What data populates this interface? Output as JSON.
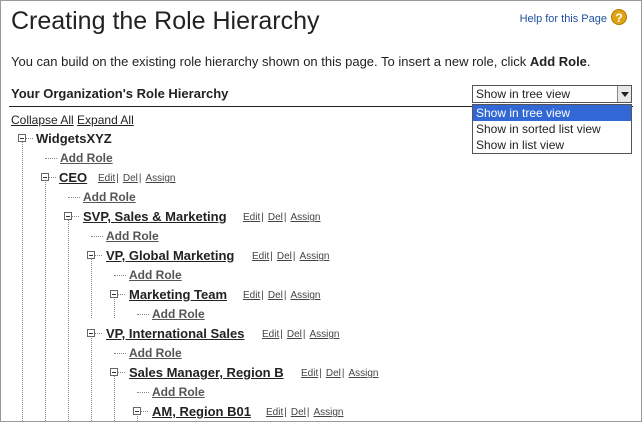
{
  "header": {
    "title": "Creating the Role Hierarchy",
    "help_link": "Help for this Page",
    "help_icon": "?"
  },
  "intro": {
    "text": "You can build on the existing role hierarchy shown on this page. To insert a new role, click ",
    "emphasis": "Add Role",
    "end": "."
  },
  "section": {
    "title": "Your Organization's Role Hierarchy"
  },
  "view_select": {
    "value": "Show in tree view",
    "options": [
      "Show in tree view",
      "Show in sorted list view",
      "Show in list view"
    ]
  },
  "tree_controls": {
    "collapse": "Collapse All",
    "expand": "Expand All"
  },
  "actions": {
    "edit": "Edit",
    "del": "Del",
    "assign": "Assign",
    "sep": "|"
  },
  "add_role_label": "Add Role",
  "nodes": [
    {
      "label": "WidgetsXYZ"
    },
    {
      "label": "CEO"
    },
    {
      "label": "SVP, Sales & Marketing"
    },
    {
      "label": "VP, Global Marketing"
    },
    {
      "label": "Marketing Team"
    },
    {
      "label": "VP, International Sales"
    },
    {
      "label": "Sales Manager, Region B"
    },
    {
      "label": "AM, Region B01"
    }
  ]
}
